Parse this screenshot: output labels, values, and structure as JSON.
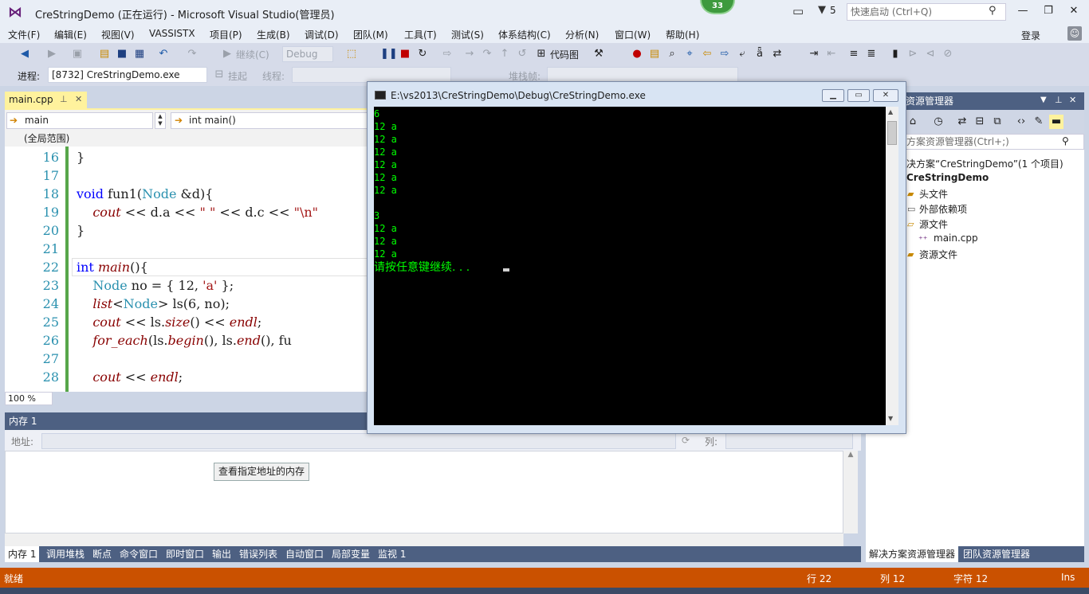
{
  "title_bar": {
    "title": "CreStringDemo (正在运行) - Microsoft Visual Studio(管理员)",
    "notification_count": "33",
    "filter_count": "5",
    "quick_launch_placeholder": "快速启动 (Ctrl+Q)"
  },
  "menu": {
    "items": [
      "文件(F)",
      "编辑(E)",
      "视图(V)",
      "VASSISTX",
      "项目(P)",
      "生成(B)",
      "调试(D)",
      "团队(M)",
      "工具(T)",
      "测试(S)",
      "体系结构(C)",
      "分析(N)",
      "窗口(W)",
      "帮助(H)"
    ],
    "signin": "登录"
  },
  "toolbar1": {
    "continue_label": "继续(C)",
    "config_value": "Debug",
    "code_map_label": "代码图"
  },
  "toolbar2": {
    "process_label": "进程:",
    "process_value": "[8732] CreStringDemo.exe",
    "suspend_label": "挂起",
    "thread_label": "线程:",
    "stack_frame_label": "堆栈帧:"
  },
  "editor": {
    "tab_label": "main.cpp",
    "nav_left": "main",
    "nav_right": "int main()",
    "scope": "(全局范围)",
    "zoom": "100 %",
    "lines": [
      {
        "n": "16",
        "code": "}"
      },
      {
        "n": "17",
        "code": ""
      },
      {
        "n": "18",
        "code": "void fun1(Node &d){"
      },
      {
        "n": "19",
        "code": "    cout << d.a << \" \" << d.c << \"\\n\""
      },
      {
        "n": "20",
        "code": "}"
      },
      {
        "n": "21",
        "code": ""
      },
      {
        "n": "22",
        "code": "int main(){"
      },
      {
        "n": "23",
        "code": "    Node no = { 12, 'a' };"
      },
      {
        "n": "24",
        "code": "    list<Node> ls(6, no);"
      },
      {
        "n": "25",
        "code": "    cout << ls.size() << endl;"
      },
      {
        "n": "26",
        "code": "    for_each(ls.begin(), ls.end(), fu"
      },
      {
        "n": "27",
        "code": ""
      },
      {
        "n": "28",
        "code": "    cout << endl;"
      }
    ]
  },
  "memory": {
    "title": "内存 1",
    "address_label": "地址:",
    "column_label": "列:",
    "view_button": "查看指定地址的内存"
  },
  "bottom_tabs": [
    "内存 1",
    "调用堆栈",
    "断点",
    "命令窗口",
    "即时窗口",
    "输出",
    "错误列表",
    "自动窗口",
    "局部变量",
    "监视 1"
  ],
  "solution_explorer": {
    "title": "资源管理器",
    "search_placeholder": "方案资源管理器(Ctrl+;)",
    "solution": "决方案“CreStringDemo”(1 个项目)",
    "project": "CreStringDemo",
    "items": [
      "头文件",
      "外部依赖项",
      "源文件",
      "main.cpp",
      "资源文件"
    ],
    "tabs": [
      "解决方案资源管理器",
      "团队资源管理器"
    ]
  },
  "console": {
    "title": "E:\\vs2013\\CreStringDemo\\Debug\\CreStringDemo.exe",
    "lines": [
      "6",
      "12 a",
      "12 a",
      "12 a",
      "12 a",
      "12 a",
      "12 a",
      "",
      "3",
      "12 a",
      "12 a",
      "12 a"
    ],
    "prompt": "请按任意键继续. . ."
  },
  "status_bar": {
    "state": "就绪",
    "line": "行 22",
    "col": "列 12",
    "char": "字符 12",
    "mode": "Ins"
  },
  "colors": {
    "status_bar": "#ca5100",
    "pane_title": "#4d6082",
    "tab_active": "#fff29d",
    "console_text": "#00ff00"
  }
}
